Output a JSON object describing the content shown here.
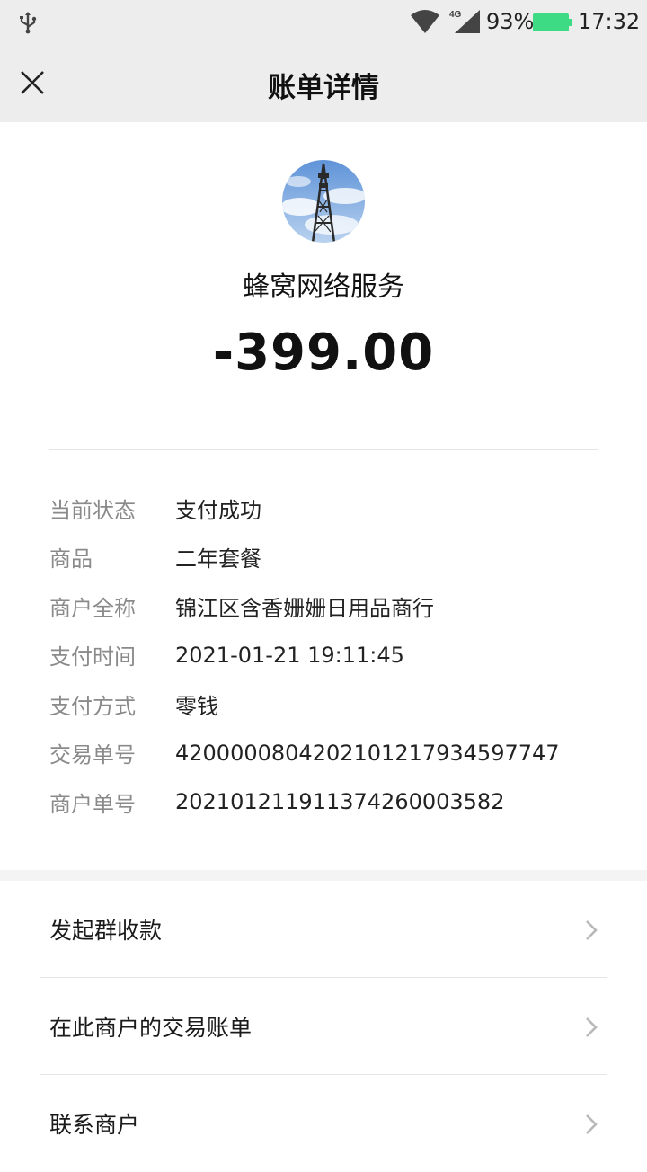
{
  "status_bar": {
    "battery_percent": "93%",
    "time": "17:32",
    "network": "4G",
    "battery_color": "#3ddc84",
    "icons": [
      "usb-icon",
      "wifi-icon",
      "signal-icon",
      "battery-icon"
    ]
  },
  "header": {
    "title": "账单详情",
    "close_icon": "close-icon"
  },
  "merchant": {
    "avatar_icon": "cell-tower-avatar",
    "name": "蜂窝网络服务",
    "amount": "-399.00"
  },
  "details": [
    {
      "label": "当前状态",
      "value": "支付成功"
    },
    {
      "label": "商品",
      "value": "二年套餐"
    },
    {
      "label": "商户全称",
      "value": "锦江区含香姗姗日用品商行"
    },
    {
      "label": "支付时间",
      "value": "2021-01-21 19:11:45"
    },
    {
      "label": "支付方式",
      "value": "零钱"
    },
    {
      "label": "交易单号",
      "value": "4200000804202101217934597747"
    },
    {
      "label": "商户单号",
      "value": "20210121191137426000358​2"
    }
  ],
  "actions": [
    {
      "label": "发起群收款"
    },
    {
      "label": "在此商户的交易账单"
    },
    {
      "label": "联系商户"
    }
  ]
}
